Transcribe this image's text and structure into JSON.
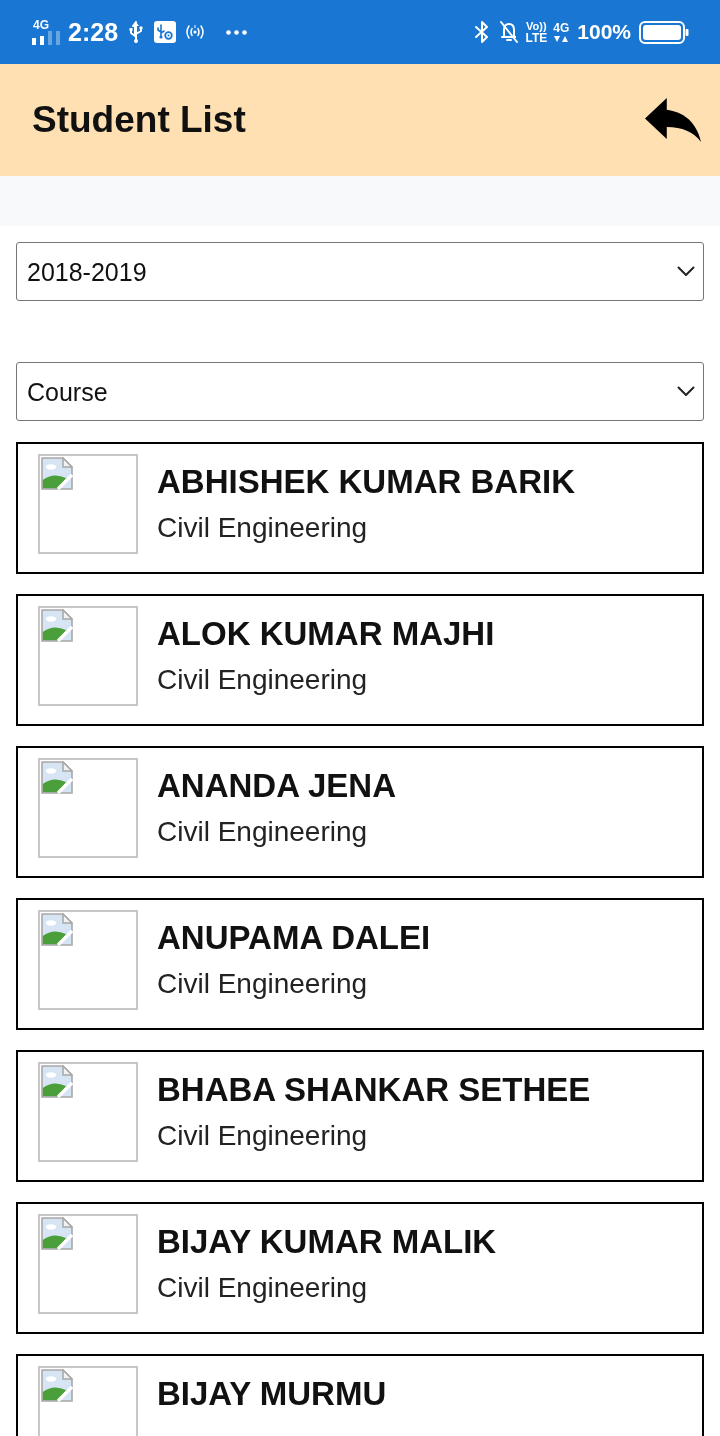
{
  "status_bar": {
    "network_type": "4G",
    "time": "2:28",
    "volte_top": "Vo))",
    "volte_bottom": "LTE",
    "data_type": "4G",
    "battery": "100%"
  },
  "header": {
    "title": "Student List"
  },
  "filters": [
    {
      "value": "2018-2019"
    },
    {
      "value": "Course"
    }
  ],
  "students": [
    {
      "name": "ABHISHEK KUMAR BARIK",
      "course": "Civil Engineering"
    },
    {
      "name": "ALOK KUMAR MAJHI",
      "course": "Civil Engineering"
    },
    {
      "name": "ANANDA JENA",
      "course": "Civil Engineering"
    },
    {
      "name": "ANUPAMA DALEI",
      "course": "Civil Engineering"
    },
    {
      "name": "BHABA SHANKAR SETHEE",
      "course": "Civil Engineering"
    },
    {
      "name": "BIJAY KUMAR MALIK",
      "course": "Civil Engineering"
    },
    {
      "name": "BIJAY MURMU"
    }
  ]
}
